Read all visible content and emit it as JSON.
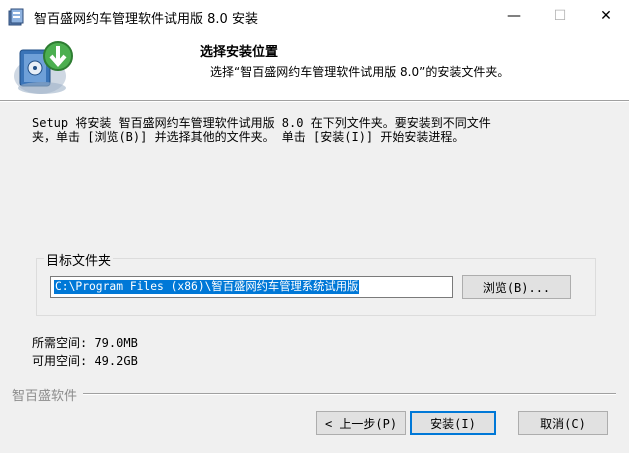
{
  "window": {
    "title": "智百盛网约车管理软件试用版 8.0 安装",
    "minimize_glyph": "—",
    "maximize_glyph": "☐",
    "close_glyph": "✕"
  },
  "header": {
    "title": "选择安装位置",
    "subtitle": "选择“智百盛网约车管理软件试用版 8.0”的安装文件夹。"
  },
  "description": "Setup 将安装 智百盛网约车管理软件试用版 8.0 在下列文件夹。要安装到不同文件\n夹，单击 [浏览(B)] 并选择其他的文件夹。 单击 [安装(I)] 开始安装进程。",
  "destination": {
    "group_label": "目标文件夹",
    "path_value": "C:\\Program Files (x86)\\智百盛网约车管理系统试用版",
    "browse_label": "浏览(B)..."
  },
  "space": {
    "required_label": "所需空间: 79.0MB",
    "available_label": "可用空间: 49.2GB"
  },
  "brand": "智百盛软件",
  "buttons": {
    "back": "< 上一步(P)",
    "install": "安装(I)",
    "cancel": "取消(C)"
  },
  "colors": {
    "accent": "#0078d7",
    "background": "#f0f0f0"
  }
}
